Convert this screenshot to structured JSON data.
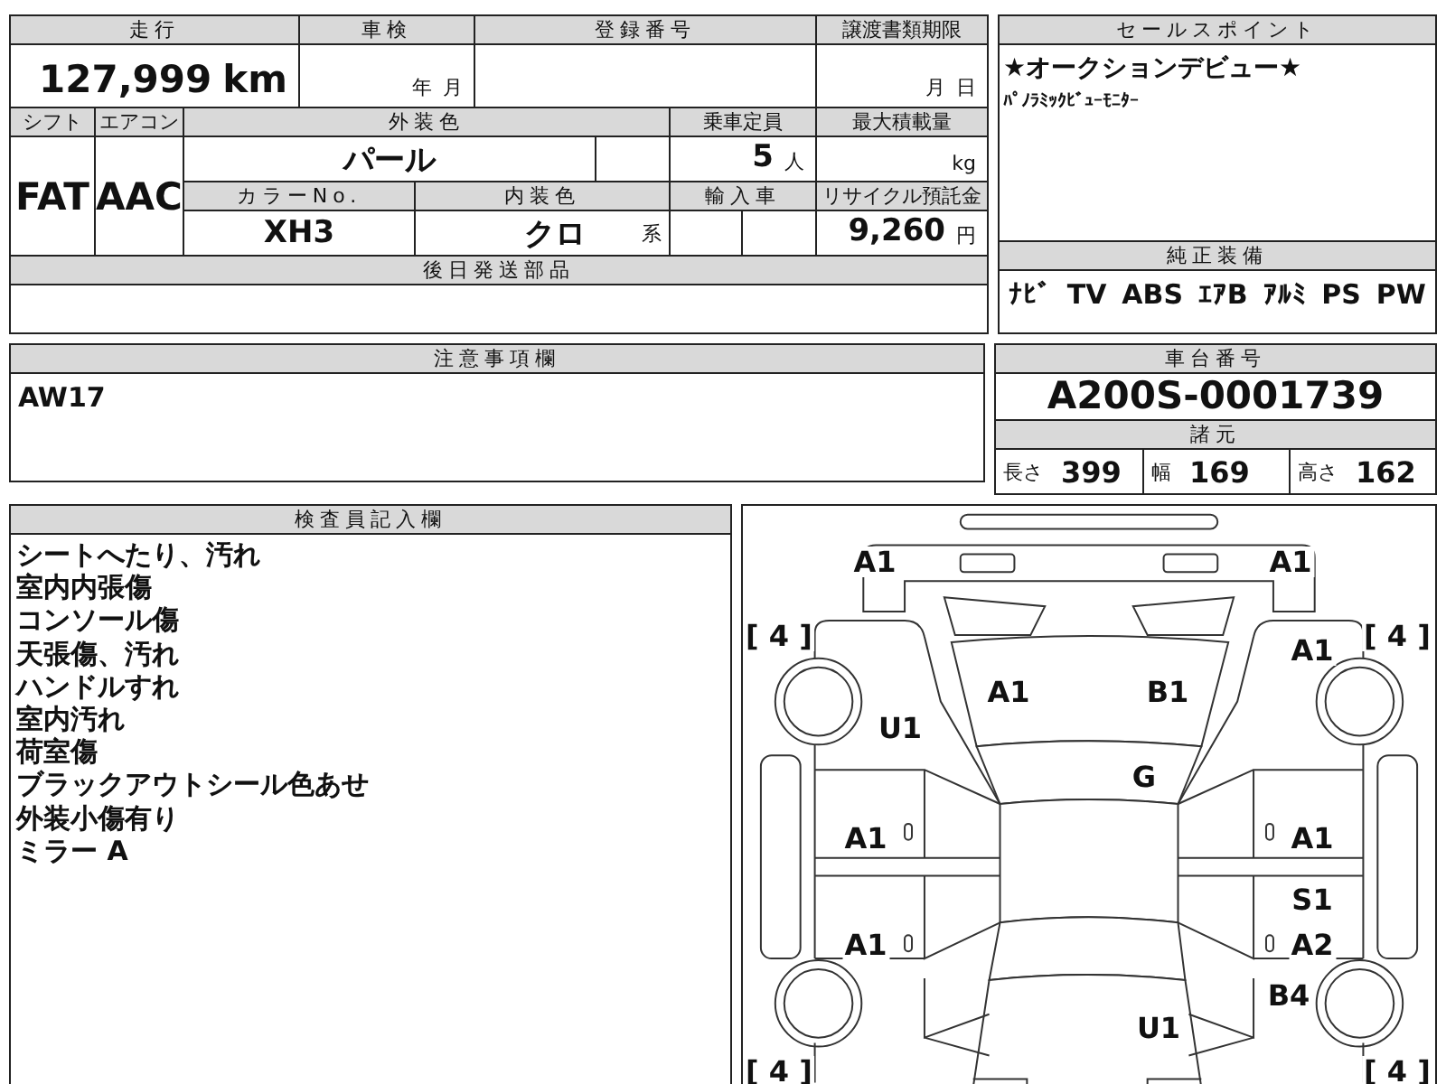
{
  "vehicle_form": {
    "mileage": {
      "label": "走行",
      "value": "127,999",
      "unit": "km"
    },
    "inspection": {
      "label": "車検",
      "year_unit": "年",
      "month_unit": "月"
    },
    "registration_number": {
      "label": "登録番号"
    },
    "transfer_deadline": {
      "label": "譲渡書類期限",
      "month_unit": "月",
      "day_unit": "日"
    },
    "shift": {
      "label": "シフト",
      "value": "FAT"
    },
    "air_conditioner": {
      "label": "エアコン",
      "value": "AAC"
    },
    "exterior_color": {
      "label": "外装色",
      "value": "パール"
    },
    "capacity": {
      "label": "乗車定員",
      "value": "5",
      "unit": "人"
    },
    "max_load": {
      "label": "最大積載量",
      "unit": "kg"
    },
    "color_no": {
      "label": "カラーNo.",
      "value": "XH3"
    },
    "interior_color": {
      "label": "内装色",
      "value": "クロ",
      "suffix": "系"
    },
    "imported": {
      "label": "輸入車"
    },
    "recycle_deposit": {
      "label": "リサイクル預託金",
      "value": "9,260",
      "unit": "円"
    },
    "parts_shipped_later": {
      "label": "後日発送部品"
    }
  },
  "sales_points": {
    "title": "セールスポイント",
    "lines": [
      "★オークションデビュー★",
      "ﾊﾟﾉﾗﾐｯｸﾋﾞｭｰﾓﾆﾀｰ"
    ]
  },
  "equipment": {
    "title": "純正装備",
    "items": [
      "ﾅﾋﾞ",
      "TV",
      "ABS",
      "ｴｱB",
      "ｱﾙﾐ",
      "PS",
      "PW"
    ]
  },
  "notes": {
    "title": "注意事項欄",
    "text": "AW17"
  },
  "chassis": {
    "title": "車台番号",
    "number": "A200S-0001739",
    "spec_title": "諸元",
    "specs": [
      {
        "label": "長さ",
        "value": "399"
      },
      {
        "label": "幅",
        "value": "169"
      },
      {
        "label": "高さ",
        "value": "162"
      }
    ]
  },
  "inspector": {
    "title": "検査員記入欄",
    "lines": [
      "シートへたり、汚れ",
      "室内内張傷",
      "コンソール傷",
      "天張傷、汚れ",
      "ハンドルすれ",
      "室内汚れ",
      "荷室傷",
      "ブラックアウトシール色あせ",
      "外装小傷有り",
      "ミラー A"
    ]
  },
  "diagram": {
    "marks": [
      "A1",
      "A1",
      "[ 4 ]",
      "[ 4 ]",
      "A1",
      "A1",
      "B1",
      "U1",
      "G",
      "A1",
      "A1",
      "S1",
      "A1",
      "A2",
      "B4",
      "U1",
      "[ 4 ]",
      "[ 4 ]"
    ]
  }
}
